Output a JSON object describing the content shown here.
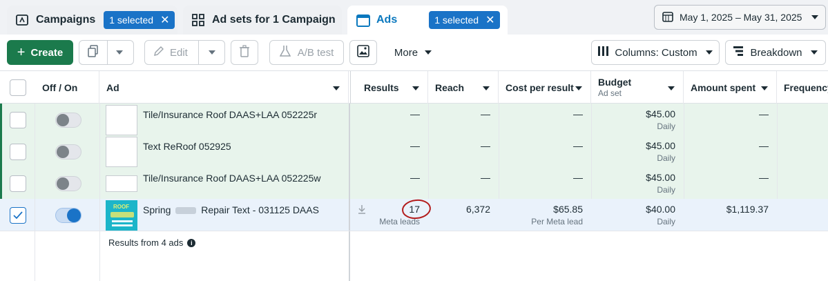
{
  "tabs": [
    {
      "label": "Campaigns",
      "badge": "1 selected"
    },
    {
      "label": "Ad sets for 1 Campaign"
    },
    {
      "label": "Ads",
      "badge": "1 selected"
    }
  ],
  "date_range": "May 1, 2025 – May 31, 2025",
  "toolbar": {
    "create": "Create",
    "edit": "Edit",
    "ab_test": "A/B test",
    "more": "More",
    "columns": "Columns: Custom",
    "breakdown": "Breakdown"
  },
  "columns": {
    "off_on": "Off / On",
    "ad": "Ad",
    "results": "Results",
    "reach": "Reach",
    "cost_per_result": "Cost per result",
    "budget": "Budget",
    "budget_sub": "Ad set",
    "amount_spent": "Amount spent",
    "frequency": "Frequency"
  },
  "rows": [
    {
      "name": "Tile/Insurance Roof DAAS+LAA 052225r",
      "results": "—",
      "reach": "—",
      "cpr": "—",
      "budget": "$45.00",
      "budget_sub": "Daily",
      "spent": "—"
    },
    {
      "name": "Text ReRoof 052925",
      "results": "—",
      "reach": "—",
      "cpr": "—",
      "budget": "$45.00",
      "budget_sub": "Daily",
      "spent": "—"
    },
    {
      "name": "Tile/Insurance Roof DAAS+LAA 052225w",
      "results": "—",
      "reach": "—",
      "cpr": "—",
      "budget": "$45.00",
      "budget_sub": "Daily",
      "spent": "—"
    },
    {
      "name_a": "Spring",
      "name_b": "Repair Text - 031125 DAAS",
      "results": "17",
      "results_sub": "Meta leads",
      "reach": "6,372",
      "cpr": "$65.85",
      "cpr_sub": "Per Meta lead",
      "budget": "$40.00",
      "budget_sub": "Daily",
      "spent": "$1,119.37",
      "thumb_text": "ROOF"
    }
  ],
  "footer": "Results from 4 ads",
  "colors": {
    "green_row": "#e8f4ec",
    "selected_row": "#eaf2fb",
    "accent": "#1a73c7",
    "create": "#1b7a4c"
  }
}
